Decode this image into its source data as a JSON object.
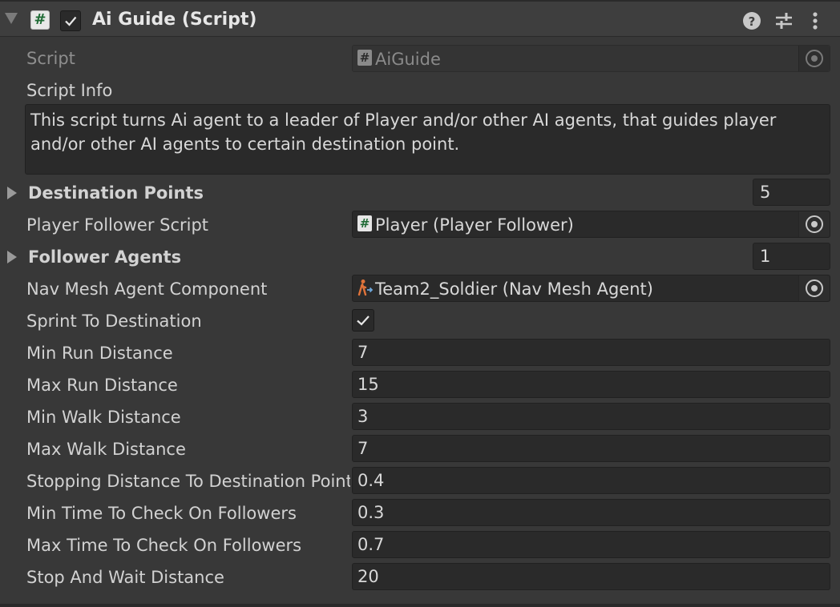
{
  "component": {
    "title": "Ai Guide (Script)",
    "enabled": true
  },
  "icons": {
    "fold": "triangle-down-icon",
    "script": "script-hash-icon",
    "help": "help-icon",
    "presets": "presets-sliders-icon",
    "menu": "kebab-menu-icon",
    "picker": "object-picker-icon",
    "navmesh": "navmesh-agent-icon"
  },
  "fields": {
    "script": {
      "label": "Script",
      "value": "AiGuide"
    },
    "script_info": {
      "label": "Script Info",
      "value": "This script turns Ai agent to a leader of Player and/or other AI agents, that guides player and/or other AI agents to certain destination point."
    },
    "destination_points": {
      "label": "Destination Points",
      "value": "5"
    },
    "player_follower_script": {
      "label": "Player Follower Script",
      "value": "Player (Player Follower)"
    },
    "follower_agents": {
      "label": "Follower Agents",
      "value": "1"
    },
    "nav_mesh_agent_component": {
      "label": "Nav Mesh Agent Component",
      "value": "Team2_Soldier (Nav Mesh Agent)"
    },
    "sprint_to_destination": {
      "label": "Sprint To Destination",
      "checked": true
    },
    "min_run_distance": {
      "label": "Min Run Distance",
      "value": "7"
    },
    "max_run_distance": {
      "label": "Max Run Distance",
      "value": "15"
    },
    "min_walk_distance": {
      "label": "Min Walk Distance",
      "value": "3"
    },
    "max_walk_distance": {
      "label": "Max Walk Distance",
      "value": "7"
    },
    "stopping_distance": {
      "label": "Stopping Distance To Destination Point",
      "value": "0.4"
    },
    "min_time_check": {
      "label": "Min Time To Check On Followers",
      "value": "0.3"
    },
    "max_time_check": {
      "label": "Max Time To Check On Followers",
      "value": "0.7"
    },
    "stop_and_wait_distance": {
      "label": "Stop And Wait Distance",
      "value": "20"
    }
  },
  "colors": {
    "background": "#383838",
    "field": "#2a2a2a",
    "text": "#d2d2d2",
    "navmesh_icon": "#e0733a"
  }
}
